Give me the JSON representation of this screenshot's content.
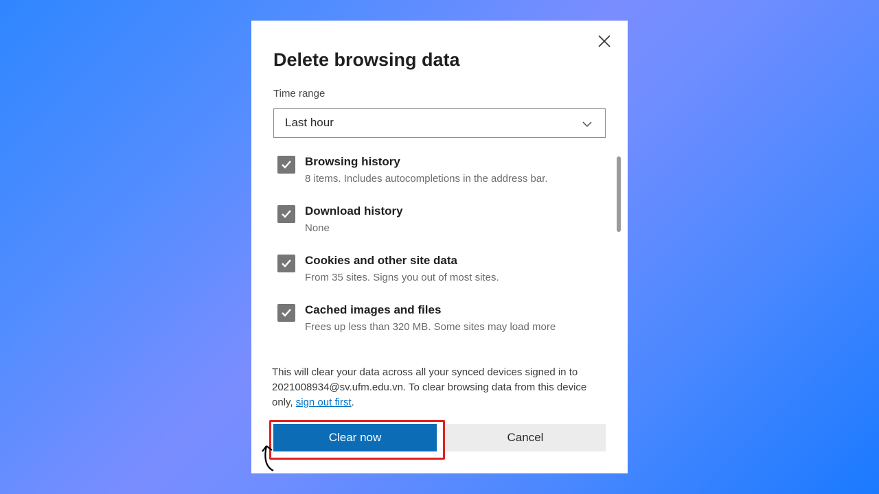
{
  "dialog": {
    "title": "Delete browsing data",
    "time_range_label": "Time range",
    "time_range_value": "Last hour",
    "items": [
      {
        "title": "Browsing history",
        "sub": "8 items. Includes autocompletions in the address bar."
      },
      {
        "title": "Download history",
        "sub": "None"
      },
      {
        "title": "Cookies and other site data",
        "sub": "From 35 sites. Signs you out of most sites."
      },
      {
        "title": "Cached images and files",
        "sub": "Frees up less than 320 MB. Some sites may load more"
      }
    ],
    "note_prefix": "This will clear your data across all your synced devices signed in to 2021008934@sv.ufm.edu.vn. To clear browsing data from this device only, ",
    "note_link": "sign out first",
    "note_suffix": ".",
    "clear_label": "Clear now",
    "cancel_label": "Cancel"
  }
}
